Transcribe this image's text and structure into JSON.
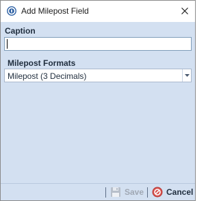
{
  "window": {
    "title": "Add Milepost Field"
  },
  "form": {
    "caption_label": "Caption",
    "caption_value": "",
    "formats_label": "Milepost Formats",
    "formats_selected": "Milepost (3 Decimals)"
  },
  "footer": {
    "save_label": "Save",
    "cancel_label": "Cancel",
    "save_enabled": false
  },
  "icons": {
    "app": "compass-icon",
    "close": "close-icon",
    "dropdown": "chevron-down-icon",
    "save": "floppy-disk-icon",
    "cancel": "cancel-icon"
  },
  "colors": {
    "panel_bg": "#d3e0f1",
    "app_icon": "#2b5fa3",
    "cancel_icon": "#d9534f"
  }
}
